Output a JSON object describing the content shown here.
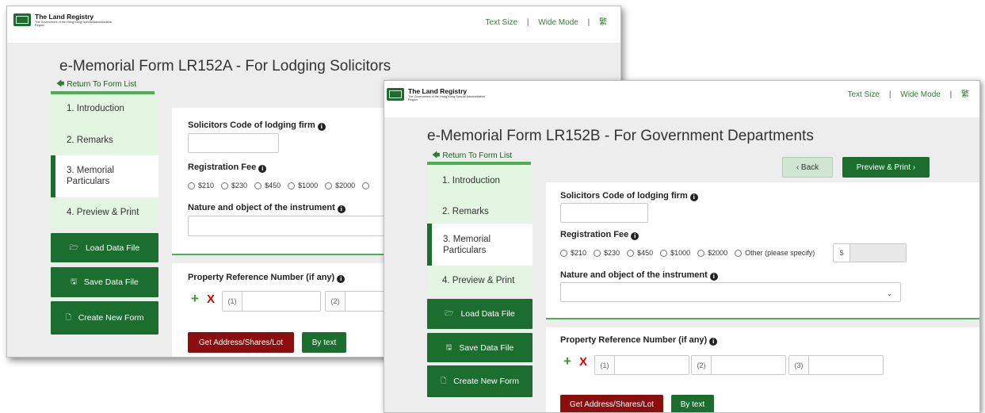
{
  "brand": {
    "name": "The Land Registry",
    "subtitle": "The Government of the Hong Kong Special Administrative Region"
  },
  "toplinks": {
    "text_size": "Text Size",
    "separator": "|",
    "wide_mode": "Wide Mode",
    "lang": "繁"
  },
  "back_window": {
    "title": "e-Memorial Form LR152A - For Lodging Solicitors",
    "return_link": "Return To Form List",
    "sidebar": [
      {
        "label": "1. Introduction"
      },
      {
        "label": "2. Remarks"
      },
      {
        "label": "3. Memorial Particulars"
      },
      {
        "label": "4. Preview & Print"
      }
    ],
    "actions": {
      "load": "Load Data File",
      "save": "Save Data File",
      "create": "Create New Form"
    },
    "fields": {
      "solicitors_code_label": "Solicitors Code of lodging firm",
      "registration_fee_label": "Registration Fee",
      "fee_options": [
        "$210",
        "$230",
        "$450",
        "$1000",
        "$2000"
      ],
      "nature_label": "Nature and object of the instrument",
      "property_ref_label": "Property Reference Number (if any)",
      "ref_prefixes": [
        "(1)",
        "(2)"
      ]
    },
    "buttons": {
      "get_address": "Get Address/Shares/Lot",
      "by_text": "By text"
    }
  },
  "front_window": {
    "title": "e-Memorial Form LR152B - For Government Departments",
    "return_link": "Return To Form List",
    "nav": {
      "back": "‹ Back",
      "preview_print": "Preview & Print  ›"
    },
    "sidebar": [
      {
        "label": "1. Introduction"
      },
      {
        "label": "2. Remarks"
      },
      {
        "label": "3. Memorial Particulars"
      },
      {
        "label": "4. Preview & Print"
      }
    ],
    "actions": {
      "load": "Load Data File",
      "save": "Save Data File",
      "create": "Create New Form"
    },
    "fields": {
      "solicitors_code_label": "Solicitors Code of lodging firm",
      "registration_fee_label": "Registration Fee",
      "fee_options": [
        "$210",
        "$230",
        "$450",
        "$1000",
        "$2000",
        "Other (please specify)"
      ],
      "currency_prefix": "$",
      "nature_label": "Nature and object of the instrument",
      "property_ref_label": "Property Reference Number (if any)",
      "ref_prefixes": [
        "(1)",
        "(2)",
        "(3)"
      ]
    },
    "buttons": {
      "get_address": "Get Address/Shares/Lot",
      "by_text": "By text"
    }
  },
  "symbols": {
    "info": "i",
    "plus": "+",
    "remove": "X",
    "return_arrow": "🡄",
    "caret": "⌄",
    "folder": "🗁",
    "save": "🖫",
    "file": "🗋"
  },
  "colors": {
    "brand_green": "#1b6e2e",
    "sidebar_bg": "#e3f6e1",
    "accent_line": "#4caf50",
    "danger_red": "#8b0e0e",
    "link_green": "#2e7d32"
  }
}
